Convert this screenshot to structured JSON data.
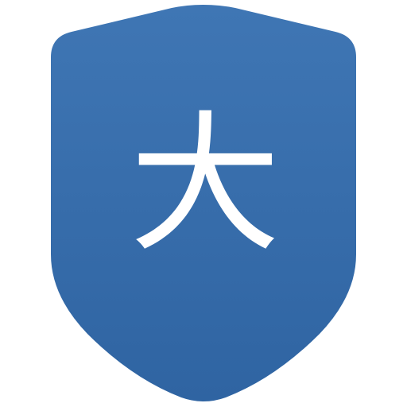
{
  "badge": {
    "glyph": "大",
    "colors": {
      "shield_top": "#3F76B4",
      "shield_bottom": "#2F64A2",
      "glyph": "#FFFFFF",
      "background": "#FFFFFF"
    }
  }
}
